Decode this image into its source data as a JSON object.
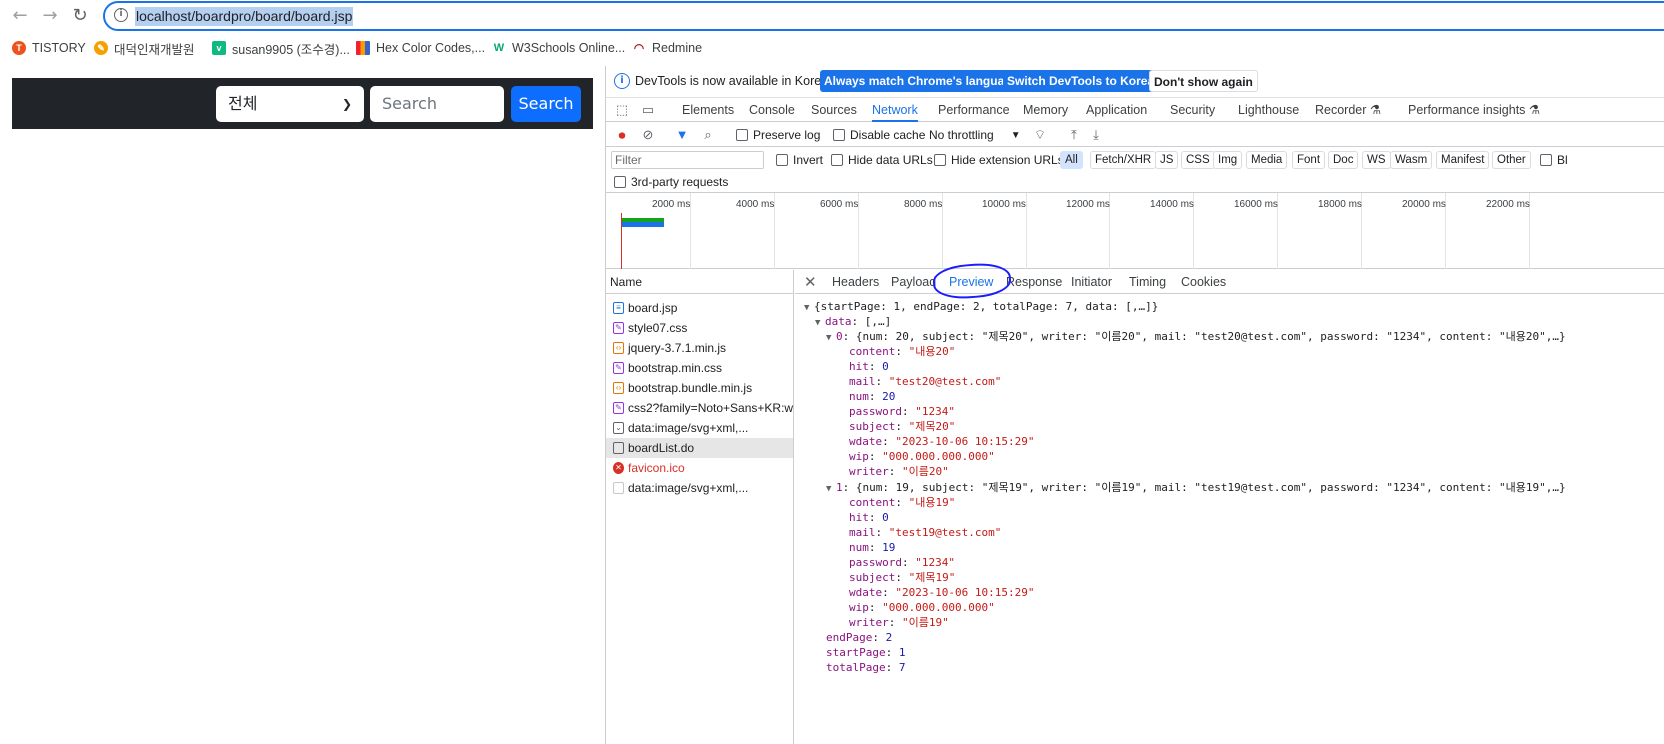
{
  "browser": {
    "url": "localhost/boardpro/board/board.jsp",
    "bookmarks": [
      {
        "label": "TISTORY",
        "color": "#eb531f"
      },
      {
        "label": "대덕인재개발원",
        "color": "#f4a000"
      },
      {
        "label": "susan9905 (조수경)...",
        "color": "#10b981"
      },
      {
        "label": "Hex Color Codes,...",
        "color": "#6a3dcc"
      },
      {
        "label": "W3Schools Online...",
        "color": "#04aa6d"
      },
      {
        "label": "Redmine",
        "color": "#b32024"
      }
    ]
  },
  "page": {
    "category": "전체",
    "search_placeholder": "Search",
    "search_button": "Search"
  },
  "devtools": {
    "infobar": {
      "text": "DevTools is now available in Korean!",
      "btn_match": "Always match Chrome's language",
      "btn_switch": "Switch DevTools to Korean",
      "btn_dismiss": "Don't show again"
    },
    "tabs": [
      "Elements",
      "Console",
      "Sources",
      "Network",
      "Performance",
      "Memory",
      "Application",
      "Security",
      "Lighthouse",
      "Recorder",
      "Performance insights"
    ],
    "active_tab": "Network",
    "toolbar": {
      "preserve_log": "Preserve log",
      "disable_cache": "Disable cache",
      "throttling": "No throttling"
    },
    "filter": {
      "placeholder": "Filter",
      "invert": "Invert",
      "hide_data_urls": "Hide data URLs",
      "hide_extension_urls": "Hide extension URLs",
      "types": [
        "All",
        "Fetch/XHR",
        "JS",
        "CSS",
        "Img",
        "Media",
        "Font",
        "Doc",
        "WS",
        "Wasm",
        "Manifest",
        "Other"
      ],
      "blocked_cut": "Bl",
      "third_party": "3rd-party requests"
    },
    "overview_ticks": [
      "2000 ms",
      "4000 ms",
      "6000 ms",
      "8000 ms",
      "10000 ms",
      "12000 ms",
      "14000 ms",
      "16000 ms",
      "18000 ms",
      "20000 ms",
      "22000 ms"
    ],
    "requests": {
      "header": "Name",
      "rows": [
        {
          "name": "board.jsp",
          "color": "#1a73e8"
        },
        {
          "name": "style07.css",
          "color": "#9334e6"
        },
        {
          "name": "jquery-3.7.1.min.js",
          "color": "#e37400"
        },
        {
          "name": "bootstrap.min.css",
          "color": "#9334e6"
        },
        {
          "name": "bootstrap.bundle.min.js",
          "color": "#e37400"
        },
        {
          "name": "css2?family=Noto+Sans+KR:w...",
          "color": "#9334e6"
        },
        {
          "name": "data:image/svg+xml,...",
          "color": "#5f6368"
        },
        {
          "name": "boardList.do",
          "color": "#5f6368"
        },
        {
          "name": "favicon.ico",
          "color": "#d93025"
        },
        {
          "name": "data:image/svg+xml,...",
          "color": "#9aa0a6"
        }
      ]
    },
    "detail_tabs": [
      "Headers",
      "Payload",
      "Preview",
      "Response",
      "Initiator",
      "Timing",
      "Cookies"
    ],
    "active_detail_tab": "Preview",
    "preview": {
      "root": "{startPage: 1, endPage: 2, totalPage: 7, data: [,…]}",
      "data_key": "data",
      "data_summary": "[,…]",
      "items": [
        {
          "index": "0",
          "summary": "{num: 20, subject: \"제목20\", writer: \"이름20\", mail: \"test20@test.com\", password: \"1234\", content: \"내용20\",…}",
          "fields": [
            {
              "k": "content",
              "v": "\"내용20\"",
              "t": "s"
            },
            {
              "k": "hit",
              "v": "0",
              "t": "n"
            },
            {
              "k": "mail",
              "v": "\"test20@test.com\"",
              "t": "s"
            },
            {
              "k": "num",
              "v": "20",
              "t": "n"
            },
            {
              "k": "password",
              "v": "\"1234\"",
              "t": "s"
            },
            {
              "k": "subject",
              "v": "\"제목20\"",
              "t": "s"
            },
            {
              "k": "wdate",
              "v": "\"2023-10-06 10:15:29\"",
              "t": "s"
            },
            {
              "k": "wip",
              "v": "\"000.000.000.000\"",
              "t": "s"
            },
            {
              "k": "writer",
              "v": "\"이름20\"",
              "t": "s"
            }
          ]
        },
        {
          "index": "1",
          "summary": "{num: 19, subject: \"제목19\", writer: \"이름19\", mail: \"test19@test.com\", password: \"1234\", content: \"내용19\",…}",
          "fields": [
            {
              "k": "content",
              "v": "\"내용19\"",
              "t": "s"
            },
            {
              "k": "hit",
              "v": "0",
              "t": "n"
            },
            {
              "k": "mail",
              "v": "\"test19@test.com\"",
              "t": "s"
            },
            {
              "k": "num",
              "v": "19",
              "t": "n"
            },
            {
              "k": "password",
              "v": "\"1234\"",
              "t": "s"
            },
            {
              "k": "subject",
              "v": "\"제목19\"",
              "t": "s"
            },
            {
              "k": "wdate",
              "v": "\"2023-10-06 10:15:29\"",
              "t": "s"
            },
            {
              "k": "wip",
              "v": "\"000.000.000.000\"",
              "t": "s"
            },
            {
              "k": "writer",
              "v": "\"이름19\"",
              "t": "s"
            }
          ]
        }
      ],
      "trailing": [
        {
          "k": "endPage",
          "v": "2"
        },
        {
          "k": "startPage",
          "v": "1"
        },
        {
          "k": "totalPage",
          "v": "7"
        }
      ]
    }
  }
}
